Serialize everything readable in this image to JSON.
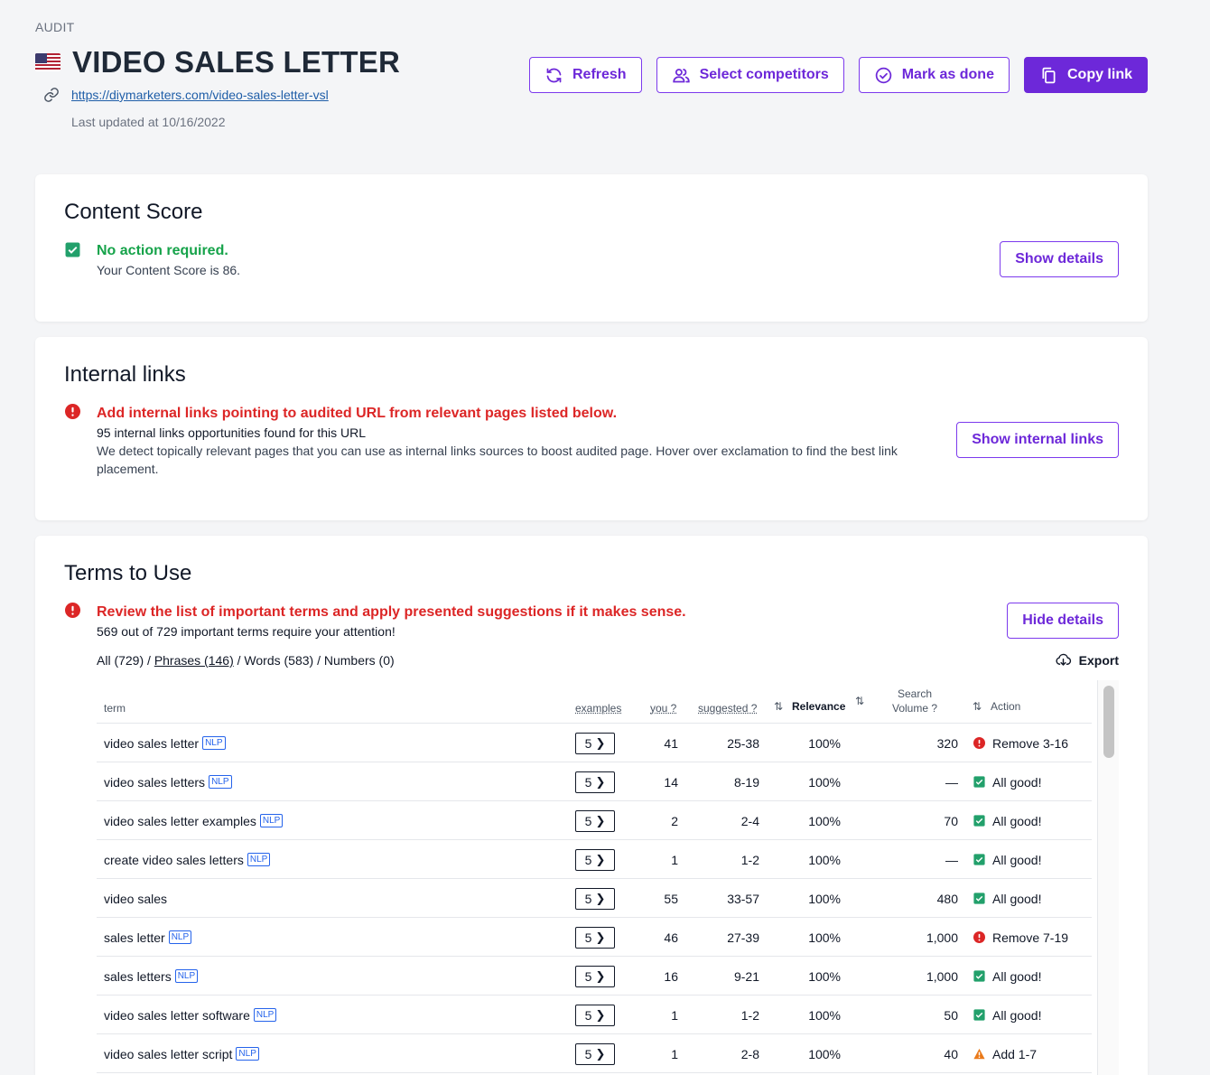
{
  "header": {
    "crumb": "AUDIT",
    "title": "VIDEO SALES LETTER",
    "url": "https://diymarketers.com/video-sales-letter-vsl",
    "updated": "Last updated at 10/16/2022",
    "flag_icon": "us-flag-icon",
    "actions": {
      "refresh": "Refresh",
      "select_competitors": "Select competitors",
      "mark_done": "Mark as done",
      "copy_link": "Copy link"
    }
  },
  "content_score": {
    "title": "Content Score",
    "status": "No action required.",
    "detail": "Your Content Score is 86.",
    "button": "Show details"
  },
  "internal_links": {
    "title": "Internal links",
    "status": "Add internal links pointing to audited URL from relevant pages listed below.",
    "count_text": "95 internal links opportunities found for this URL",
    "detail": "We detect topically relevant pages that you can use as internal links sources to boost audited page. Hover over exclamation to find the best link placement.",
    "button": "Show internal links"
  },
  "terms": {
    "title": "Terms to Use",
    "status": "Review the list of important terms and apply presented suggestions if it makes sense.",
    "count_text": "569 out of 729 important terms require your attention!",
    "button": "Hide details",
    "export": "Export",
    "filters": {
      "all": "All (729)",
      "sep": " / ",
      "phrases": "Phrases (146)",
      "words": "Words (583)",
      "numbers": "Numbers (0)"
    },
    "columns": {
      "term": "term",
      "examples": "examples",
      "you": "you ?",
      "suggested": "suggested ?",
      "relevance": "Relevance",
      "search_volume_1": "Search",
      "search_volume_2": "Volume ?",
      "action": "Action"
    },
    "colors": {
      "ok": "#16a34a",
      "error": "#dc2626",
      "warn": "#ea7a1a",
      "accent": "#6d28d9"
    },
    "rows": [
      {
        "term": "video sales letter",
        "nlp": "NLP",
        "examples": "5",
        "you": "41",
        "suggested": "25-38",
        "relevance": "100%",
        "volume": "320",
        "status": "error",
        "action": "Remove 3-16"
      },
      {
        "term": "video sales letters",
        "nlp": "NLP",
        "examples": "5",
        "you": "14",
        "suggested": "8-19",
        "relevance": "100%",
        "volume": "—",
        "status": "ok",
        "action": "All good!"
      },
      {
        "term": "video sales letter examples",
        "nlp": "NLP",
        "examples": "5",
        "you": "2",
        "suggested": "2-4",
        "relevance": "100%",
        "volume": "70",
        "status": "ok",
        "action": "All good!"
      },
      {
        "term": "create video sales letters",
        "nlp": "NLP",
        "examples": "5",
        "you": "1",
        "suggested": "1-2",
        "relevance": "100%",
        "volume": "—",
        "status": "ok",
        "action": "All good!"
      },
      {
        "term": "video sales",
        "nlp": "",
        "examples": "5",
        "you": "55",
        "suggested": "33-57",
        "relevance": "100%",
        "volume": "480",
        "status": "ok",
        "action": "All good!"
      },
      {
        "term": "sales letter",
        "nlp": "NLP",
        "examples": "5",
        "you": "46",
        "suggested": "27-39",
        "relevance": "100%",
        "volume": "1,000",
        "status": "error",
        "action": "Remove 7-19"
      },
      {
        "term": "sales letters",
        "nlp": "NLP",
        "examples": "5",
        "you": "16",
        "suggested": "9-21",
        "relevance": "100%",
        "volume": "1,000",
        "status": "ok",
        "action": "All good!"
      },
      {
        "term": "video sales letter software",
        "nlp": "NLP",
        "examples": "5",
        "you": "1",
        "suggested": "1-2",
        "relevance": "100%",
        "volume": "50",
        "status": "ok",
        "action": "All good!"
      },
      {
        "term": "video sales letter script",
        "nlp": "NLP",
        "examples": "5",
        "you": "1",
        "suggested": "2-8",
        "relevance": "100%",
        "volume": "40",
        "status": "warn",
        "action": "Add 1-7"
      }
    ]
  }
}
